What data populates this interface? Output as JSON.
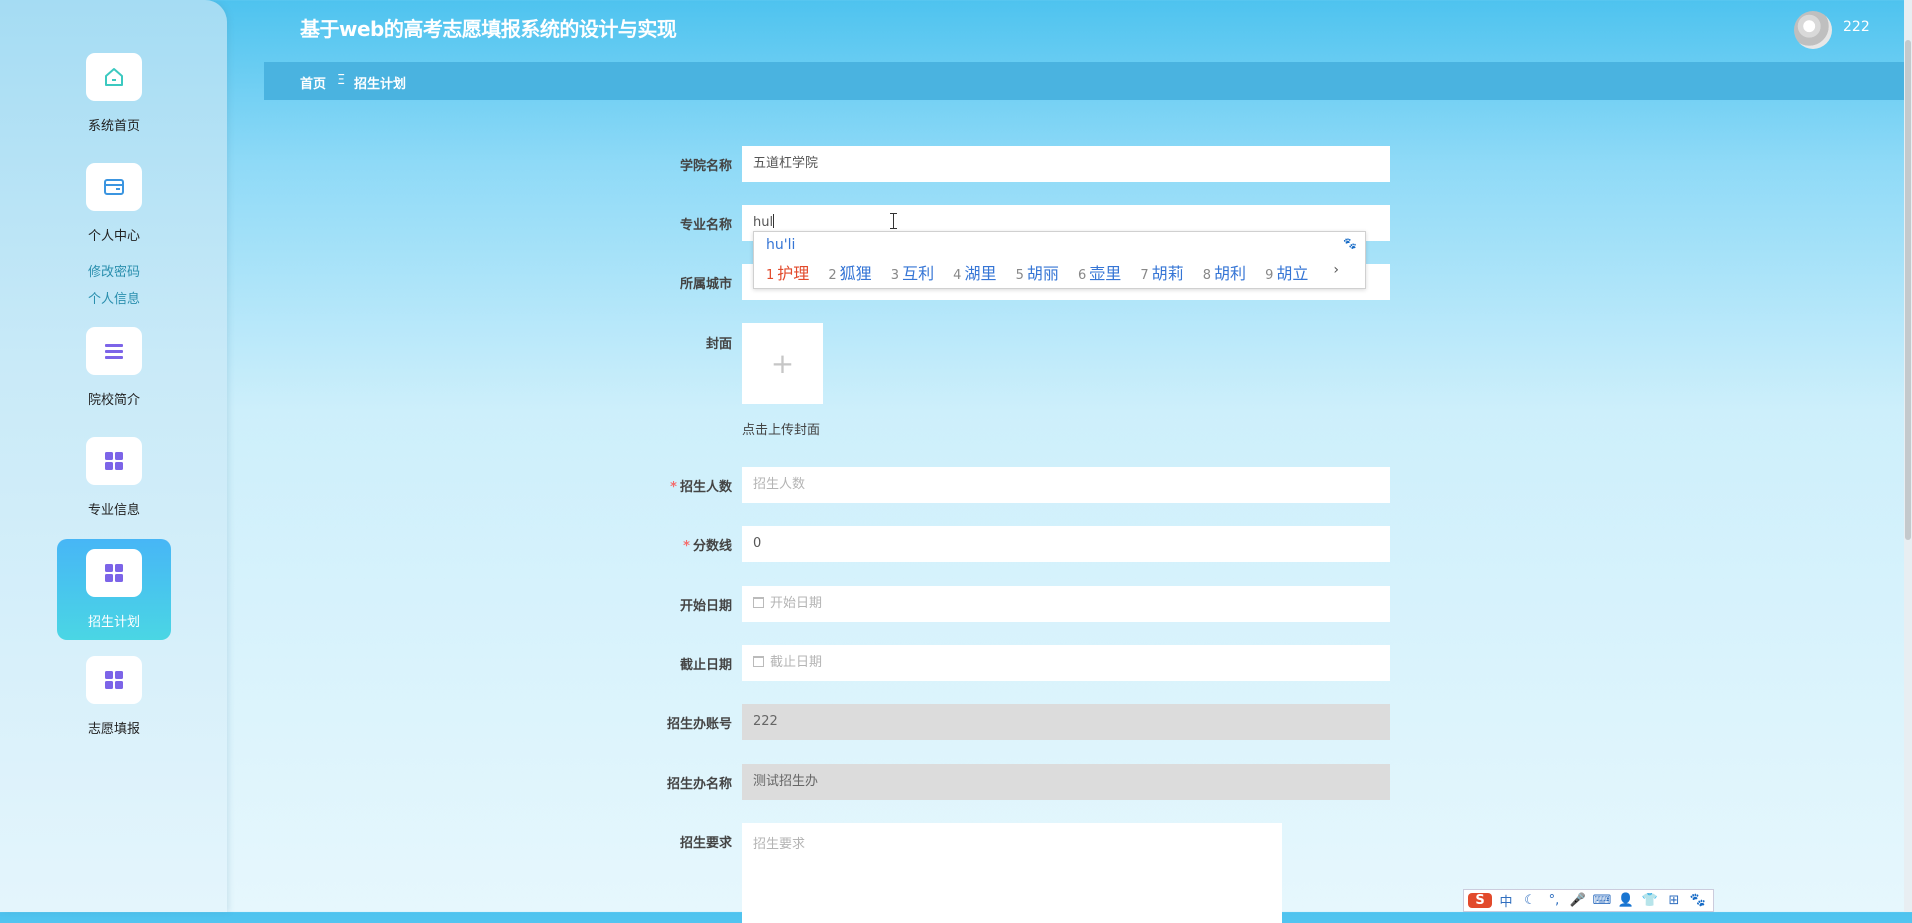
{
  "header": {
    "title": "基于web的高考志愿填报系统的设计与实现",
    "username": "222"
  },
  "breadcrumb": {
    "home": "首页",
    "separator": "Ξ",
    "current": "招生计划"
  },
  "sidebar": {
    "items": [
      {
        "label": "系统首页",
        "icon": "home-icon"
      },
      {
        "label": "个人中心",
        "icon": "wallet-icon"
      },
      {
        "label": "院校简介",
        "icon": "list-icon"
      },
      {
        "label": "专业信息",
        "icon": "grid-icon"
      },
      {
        "label": "招生计划",
        "icon": "grid-icon"
      },
      {
        "label": "志愿填报",
        "icon": "grid-icon"
      }
    ],
    "sub_links": [
      "修改密码",
      "个人信息"
    ],
    "active": "招生计划",
    "accent": "#47b6f6"
  },
  "form": {
    "college_name": {
      "label": "学院名称",
      "value": "五道杠学院"
    },
    "major_name": {
      "label": "专业名称",
      "value": "hul"
    },
    "city": {
      "label": "所属城市",
      "value": ""
    },
    "cover": {
      "label": "封面",
      "hint": "点击上传封面"
    },
    "enroll_count": {
      "label": "招生人数",
      "placeholder": "招生人数",
      "required": true
    },
    "score_line": {
      "label": "分数线",
      "value": "0",
      "required": true
    },
    "start_date": {
      "label": "开始日期",
      "placeholder": "开始日期"
    },
    "end_date": {
      "label": "截止日期",
      "placeholder": "截止日期"
    },
    "office_account": {
      "label": "招生办账号",
      "value": "222"
    },
    "office_name": {
      "label": "招生办名称",
      "value": "测试招生办"
    },
    "requirements": {
      "label": "招生要求",
      "placeholder": "招生要求"
    }
  },
  "ime": {
    "composition": "hu'li",
    "candidates": [
      {
        "n": "1",
        "text": "护理"
      },
      {
        "n": "2",
        "text": "狐狸"
      },
      {
        "n": "3",
        "text": "互利"
      },
      {
        "n": "4",
        "text": "湖里"
      },
      {
        "n": "5",
        "text": "胡丽"
      },
      {
        "n": "6",
        "text": "壶里"
      },
      {
        "n": "7",
        "text": "胡莉"
      },
      {
        "n": "8",
        "text": "胡利"
      },
      {
        "n": "9",
        "text": "胡立"
      }
    ],
    "more": "›",
    "toolbar": [
      "S",
      "中",
      "☾",
      "°,",
      "🎤",
      "⌨",
      "👤",
      "👕",
      "⊞",
      "🐾"
    ]
  }
}
